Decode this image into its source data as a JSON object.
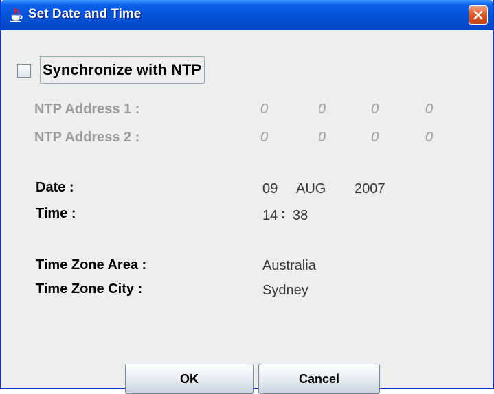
{
  "window": {
    "title": "Set Date and Time",
    "icon": "java-cup-icon",
    "close_icon": "close-icon"
  },
  "sync": {
    "checked": false,
    "label": "Synchronize with NTP"
  },
  "ntp": {
    "address1": {
      "label": "NTP Address 1 :",
      "octets": [
        "0",
        "0",
        "0",
        "0"
      ]
    },
    "address2": {
      "label": "NTP Address 2 :",
      "octets": [
        "0",
        "0",
        "0",
        "0"
      ]
    }
  },
  "date": {
    "label": "Date :",
    "day": "09",
    "month": "AUG",
    "year": "2007"
  },
  "time": {
    "label": "Time :",
    "hour": "14",
    "separator": ":",
    "minute": "38"
  },
  "timezone": {
    "area_label": "Time Zone Area :",
    "area_value": "Australia",
    "city_label": "Time Zone City :",
    "city_value": "Sydney"
  },
  "buttons": {
    "ok": "OK",
    "cancel": "Cancel"
  },
  "colors": {
    "titlebar": "#0552d6",
    "close": "#e05a2c",
    "background": "#eeeeee",
    "disabled_text": "#9c9c9c"
  }
}
